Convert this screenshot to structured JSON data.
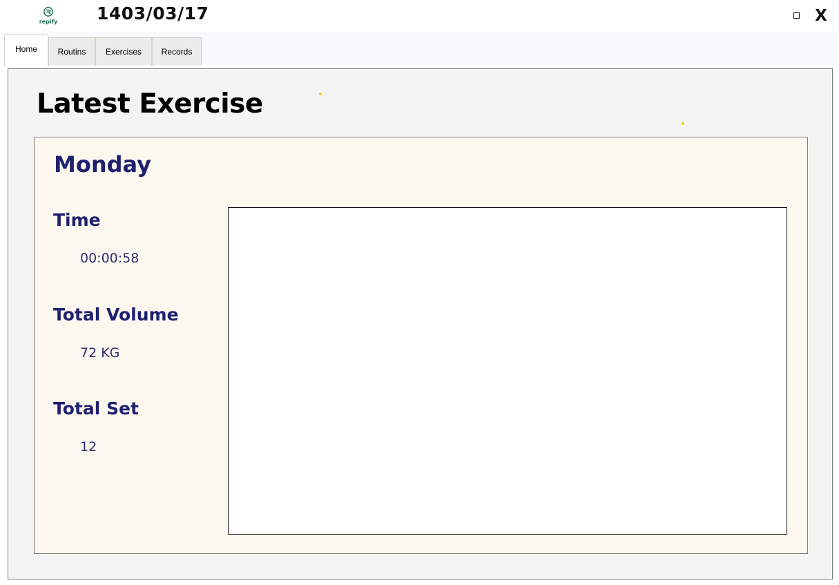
{
  "app": {
    "logo_text": "repify",
    "date": "1403/03/17"
  },
  "window_controls": {
    "maximize_icon": "square-icon",
    "close_label": "X"
  },
  "tabs": [
    {
      "label": "Home",
      "active": true
    },
    {
      "label": "Routins",
      "active": false
    },
    {
      "label": "Exercises",
      "active": false
    },
    {
      "label": "Records",
      "active": false
    }
  ],
  "home": {
    "title": "Latest Exercise",
    "card": {
      "day": "Monday",
      "stats": [
        {
          "label": "Time",
          "value": "00:00:58"
        },
        {
          "label": "Total Volume",
          "value": "72 KG"
        },
        {
          "label": "Total Set",
          "value": "12"
        }
      ]
    }
  },
  "colors": {
    "heading_text": "#1f216f",
    "value_text": "#2e2e72",
    "card_background": "#fcf8f0",
    "accent_dots": "#f2cd1a",
    "logo": "#1f6b4d"
  }
}
